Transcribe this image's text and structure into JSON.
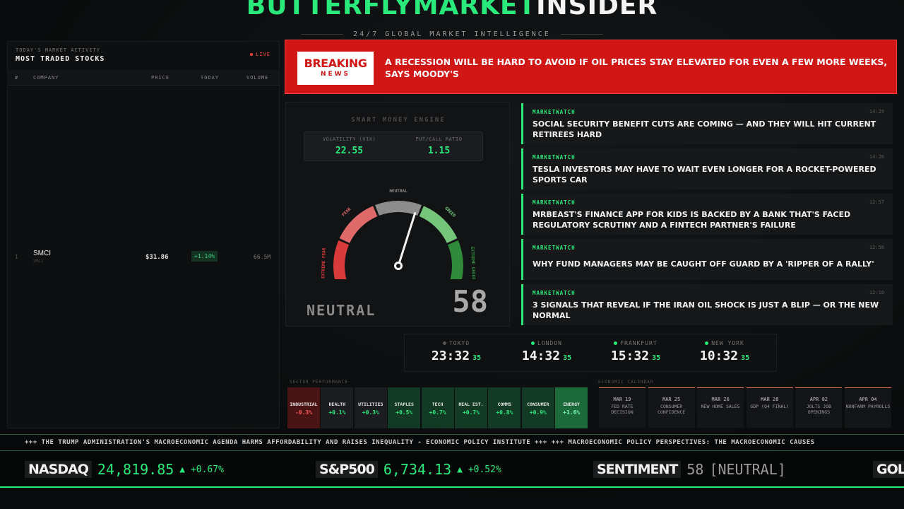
{
  "brand": {
    "green": "BUTTERFLYMARKET",
    "white": "INSIDER",
    "tagline": "24/7 GLOBAL MARKET INTELLIGENCE"
  },
  "most_traded": {
    "subtitle": "TODAY'S MARKET ACTIVITY",
    "title": "MOST TRADED STOCKS",
    "live": "LIVE",
    "columns": {
      "num": "#",
      "company": "COMPANY",
      "price": "PRICE",
      "today": "TODAY",
      "volume": "VOLUME"
    },
    "rows": [
      {
        "num": "1",
        "company": "SMCI",
        "ticker": "SMCI",
        "price": "$31.86",
        "today": "+1.14%",
        "volume": "66.5M"
      }
    ]
  },
  "breaking": {
    "line1": "BREAKING",
    "line2": "NEWS",
    "headline": "A RECESSION WILL BE HARD TO AVOID IF OIL PRICES STAY ELEVATED FOR EVEN A FEW MORE WEEKS, SAYS MOODY'S"
  },
  "engine": {
    "title": "SMART MONEY ENGINE",
    "vix_label": "VOLATILITY (VIX)",
    "vix_value": "22.55",
    "pc_label": "PUT/CALL RATIO",
    "pc_value": "1.15",
    "zones": [
      "EXTREME FEAR",
      "FEAR",
      "NEUTRAL",
      "GREED",
      "EXTREME GREED"
    ],
    "zone_colors": [
      "#d93b3b",
      "#e06a6a",
      "#8c8c8c",
      "#74c47a",
      "#2f8a3a"
    ],
    "state": "NEUTRAL",
    "value": "58",
    "score": 58
  },
  "news": [
    {
      "source": "MARKETWATCH",
      "time": "14:29",
      "headline": "SOCIAL SECURITY BENEFIT CUTS ARE COMING — AND THEY WILL HIT CURRENT RETIREES HARD"
    },
    {
      "source": "MARKETWATCH",
      "time": "14:26",
      "headline": "TESLA INVESTORS MAY HAVE TO WAIT EVEN LONGER FOR A ROCKET-POWERED SPORTS CAR"
    },
    {
      "source": "MARKETWATCH",
      "time": "12:57",
      "headline": "MRBEAST'S FINANCE APP FOR KIDS IS BACKED BY A BANK THAT'S FACED REGULATORY SCRUTINY AND A FINTECH PARTNER'S FAILURE"
    },
    {
      "source": "MARKETWATCH",
      "time": "12:56",
      "headline": "WHY FUND MANAGERS MAY BE CAUGHT OFF GUARD BY A 'RIPPER OF A RALLY'"
    },
    {
      "source": "MARKETWATCH",
      "time": "12:10",
      "headline": "3 SIGNALS THAT REVEAL IF THE IRAN OIL SHOCK IS JUST A BLIP — OR THE NEW NORMAL"
    }
  ],
  "clocks": [
    {
      "city": "TOKYO",
      "time": "23:32",
      "sec": "35",
      "open": false
    },
    {
      "city": "LONDON",
      "time": "14:32",
      "sec": "35",
      "open": true
    },
    {
      "city": "FRANKFURT",
      "time": "15:32",
      "sec": "35",
      "open": true
    },
    {
      "city": "NEW YORK",
      "time": "10:32",
      "sec": "35",
      "open": true
    }
  ],
  "sectors_label": "SECTOR PERFORMANCE",
  "sectors": [
    {
      "name": "INDUSTRIAL",
      "change": "-0.3%"
    },
    {
      "name": "HEALTH",
      "change": "+0.1%"
    },
    {
      "name": "UTILITIES",
      "change": "+0.3%"
    },
    {
      "name": "STAPLES",
      "change": "+0.5%"
    },
    {
      "name": "TECH",
      "change": "+0.7%"
    },
    {
      "name": "REAL EST.",
      "change": "+0.7%"
    },
    {
      "name": "COMMS",
      "change": "+0.8%"
    },
    {
      "name": "CONSUMER",
      "change": "+0.9%"
    },
    {
      "name": "ENERGY",
      "change": "+1.6%"
    }
  ],
  "calendar_label": "ECONOMIC CALENDAR",
  "calendar": [
    {
      "date": "MAR 19",
      "event": "FED RATE DECISION"
    },
    {
      "date": "MAR 25",
      "event": "CONSUMER CONFIDENCE"
    },
    {
      "date": "MAR 26",
      "event": "NEW HOME SALES"
    },
    {
      "date": "MAR 28",
      "event": "GDP (Q4 FINAL)"
    },
    {
      "date": "APR 02",
      "event": "JOLTS JOB OPENINGS"
    },
    {
      "date": "APR 04",
      "event": "NONFARM PAYROLLS"
    }
  ],
  "ticker": "+++ THE TRUMP ADMINISTRATION'S MACROECONOMIC AGENDA HARMS AFFORDABILITY AND RAISES INEQUALITY - ECONOMIC POLICY INSTITUTE +++ +++ MACROECONOMIC POLICY PERSPECTIVES: THE MACROECONOMIC CAUSES",
  "indices": [
    {
      "name": "NASDAQ",
      "value": "24,819.85",
      "change": "▲ +0.67%"
    },
    {
      "name": "S&P500",
      "value": "6,734.13",
      "change": "▲ +0.52%"
    },
    {
      "name": "SENTIMENT",
      "value": "58",
      "change": "[NEUTRAL]"
    },
    {
      "name": "GOL",
      "value": "",
      "change": ""
    }
  ]
}
